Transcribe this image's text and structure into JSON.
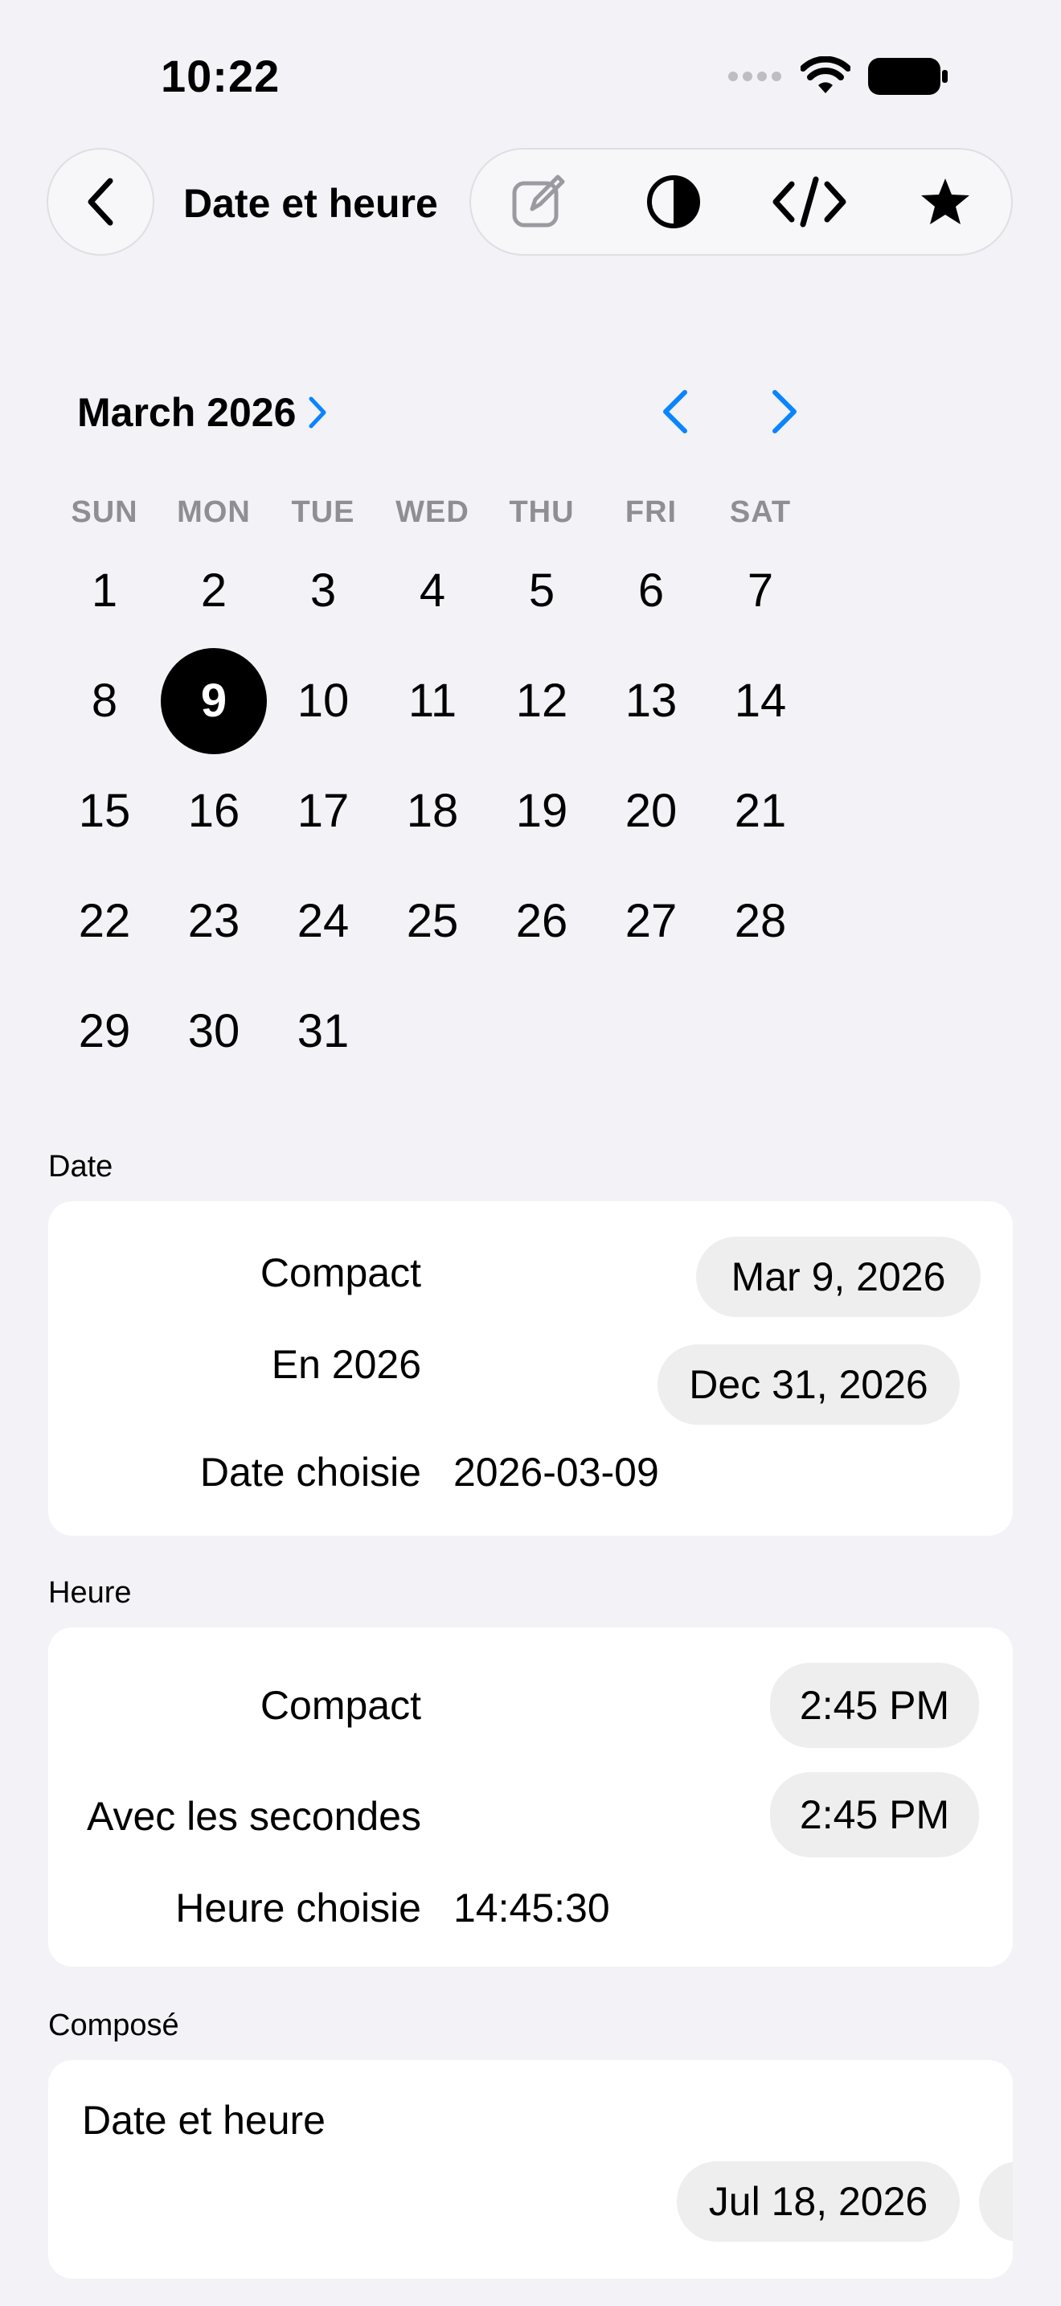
{
  "status_bar": {
    "time": "10:22"
  },
  "nav": {
    "title": "Date et heure",
    "toolbar_icons": [
      "edit-icon",
      "contrast-icon",
      "code-icon",
      "star-icon"
    ]
  },
  "calendar": {
    "month_title": "March 2026",
    "weekdays": [
      "SUN",
      "MON",
      "TUE",
      "WED",
      "THU",
      "FRI",
      "SAT"
    ],
    "days": [
      "1",
      "2",
      "3",
      "4",
      "5",
      "6",
      "7",
      "8",
      "9",
      "10",
      "11",
      "12",
      "13",
      "14",
      "15",
      "16",
      "17",
      "18",
      "19",
      "20",
      "21",
      "22",
      "23",
      "24",
      "25",
      "26",
      "27",
      "28",
      "29",
      "30",
      "31"
    ],
    "selected_day": "9",
    "accent": "#0A84FF"
  },
  "date_section": {
    "label": "Date",
    "compact_label": "Compact",
    "compact_value": "Mar 9, 2026",
    "year_label": "En 2026",
    "year_value": "Dec 31, 2026",
    "chosen_label": "Date choisie",
    "chosen_value": "2026-03-09"
  },
  "time_section": {
    "label": "Heure",
    "compact_label": "Compact",
    "compact_value": "2:45 PM",
    "seconds_label": "Avec les secondes",
    "seconds_value": "2:45 PM",
    "chosen_label": "Heure choisie",
    "chosen_value": "14:45:30"
  },
  "composed_section": {
    "label": "Composé",
    "row_label": "Date et heure",
    "date_value": "Jul 18, 2026"
  }
}
